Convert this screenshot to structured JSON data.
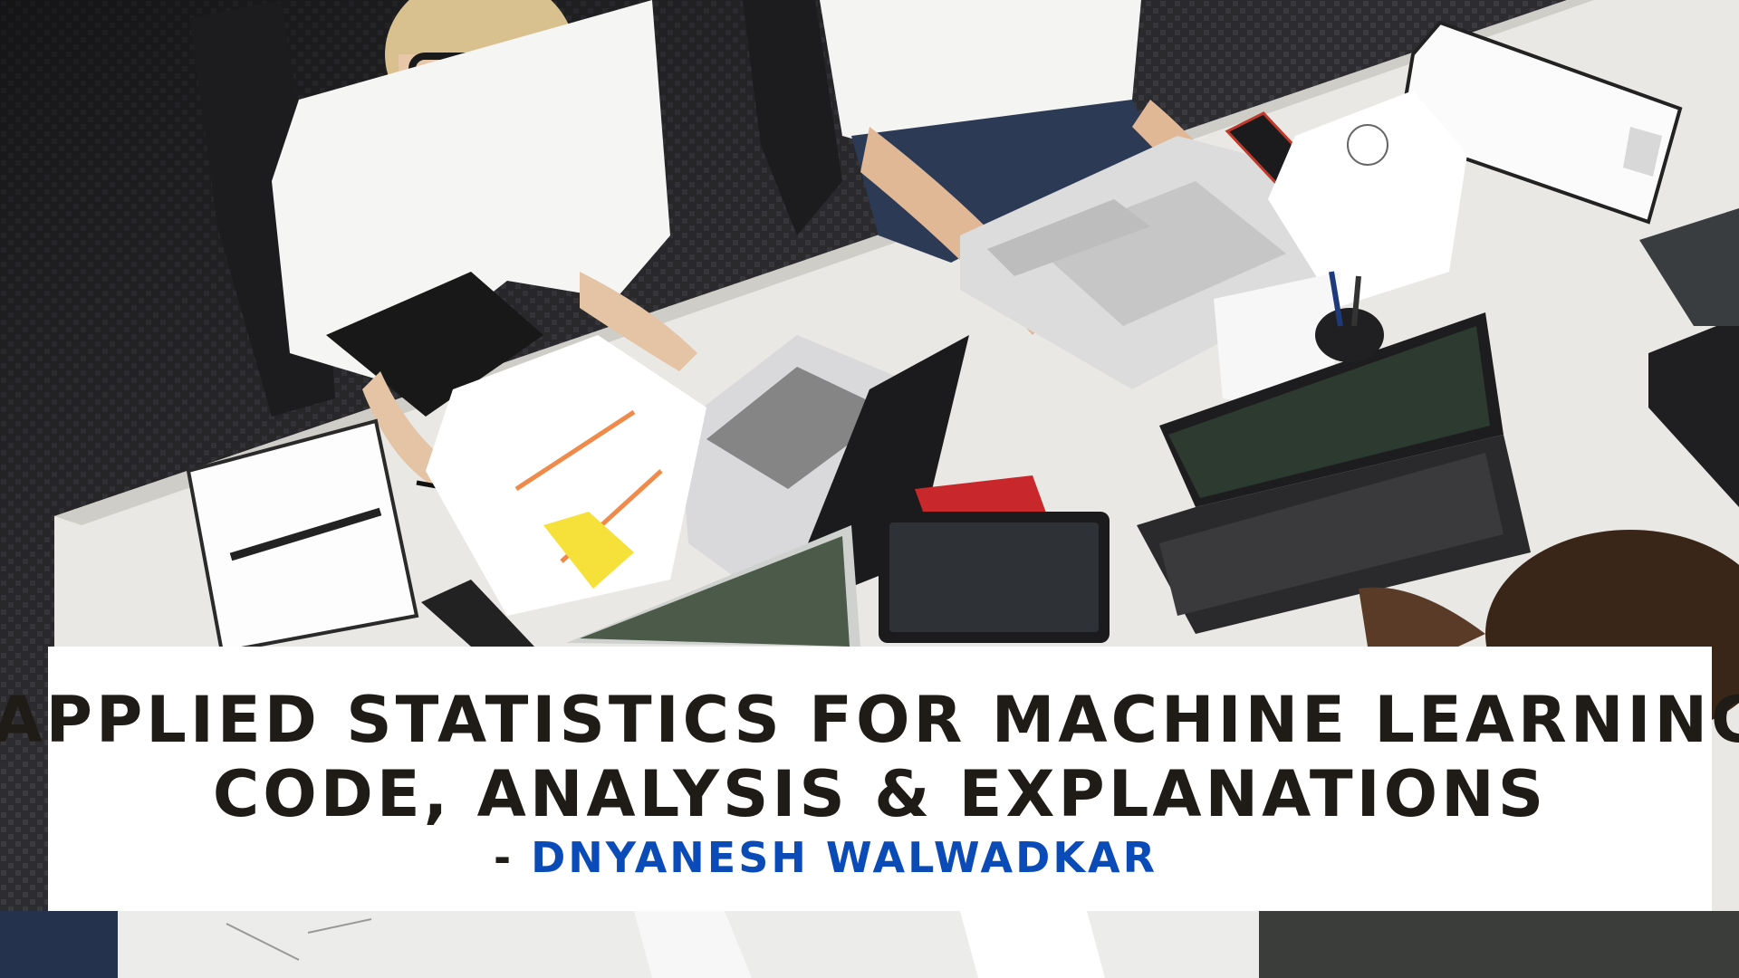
{
  "banner": {
    "title_line_1": "APPLIED STATISTICS FOR MACHINE LEARNING",
    "title_line_2": "CODE, ANALYSIS & EXPLANATIONS",
    "author_prefix": "- ",
    "author_name": "DNYANESH WALWADKAR"
  },
  "colors": {
    "title_text": "#1f1b17",
    "author_name": "#0a4bb8",
    "banner_background": "#ffffff",
    "carpet": "#2b2b2e",
    "desk": "#e9e8e4"
  }
}
